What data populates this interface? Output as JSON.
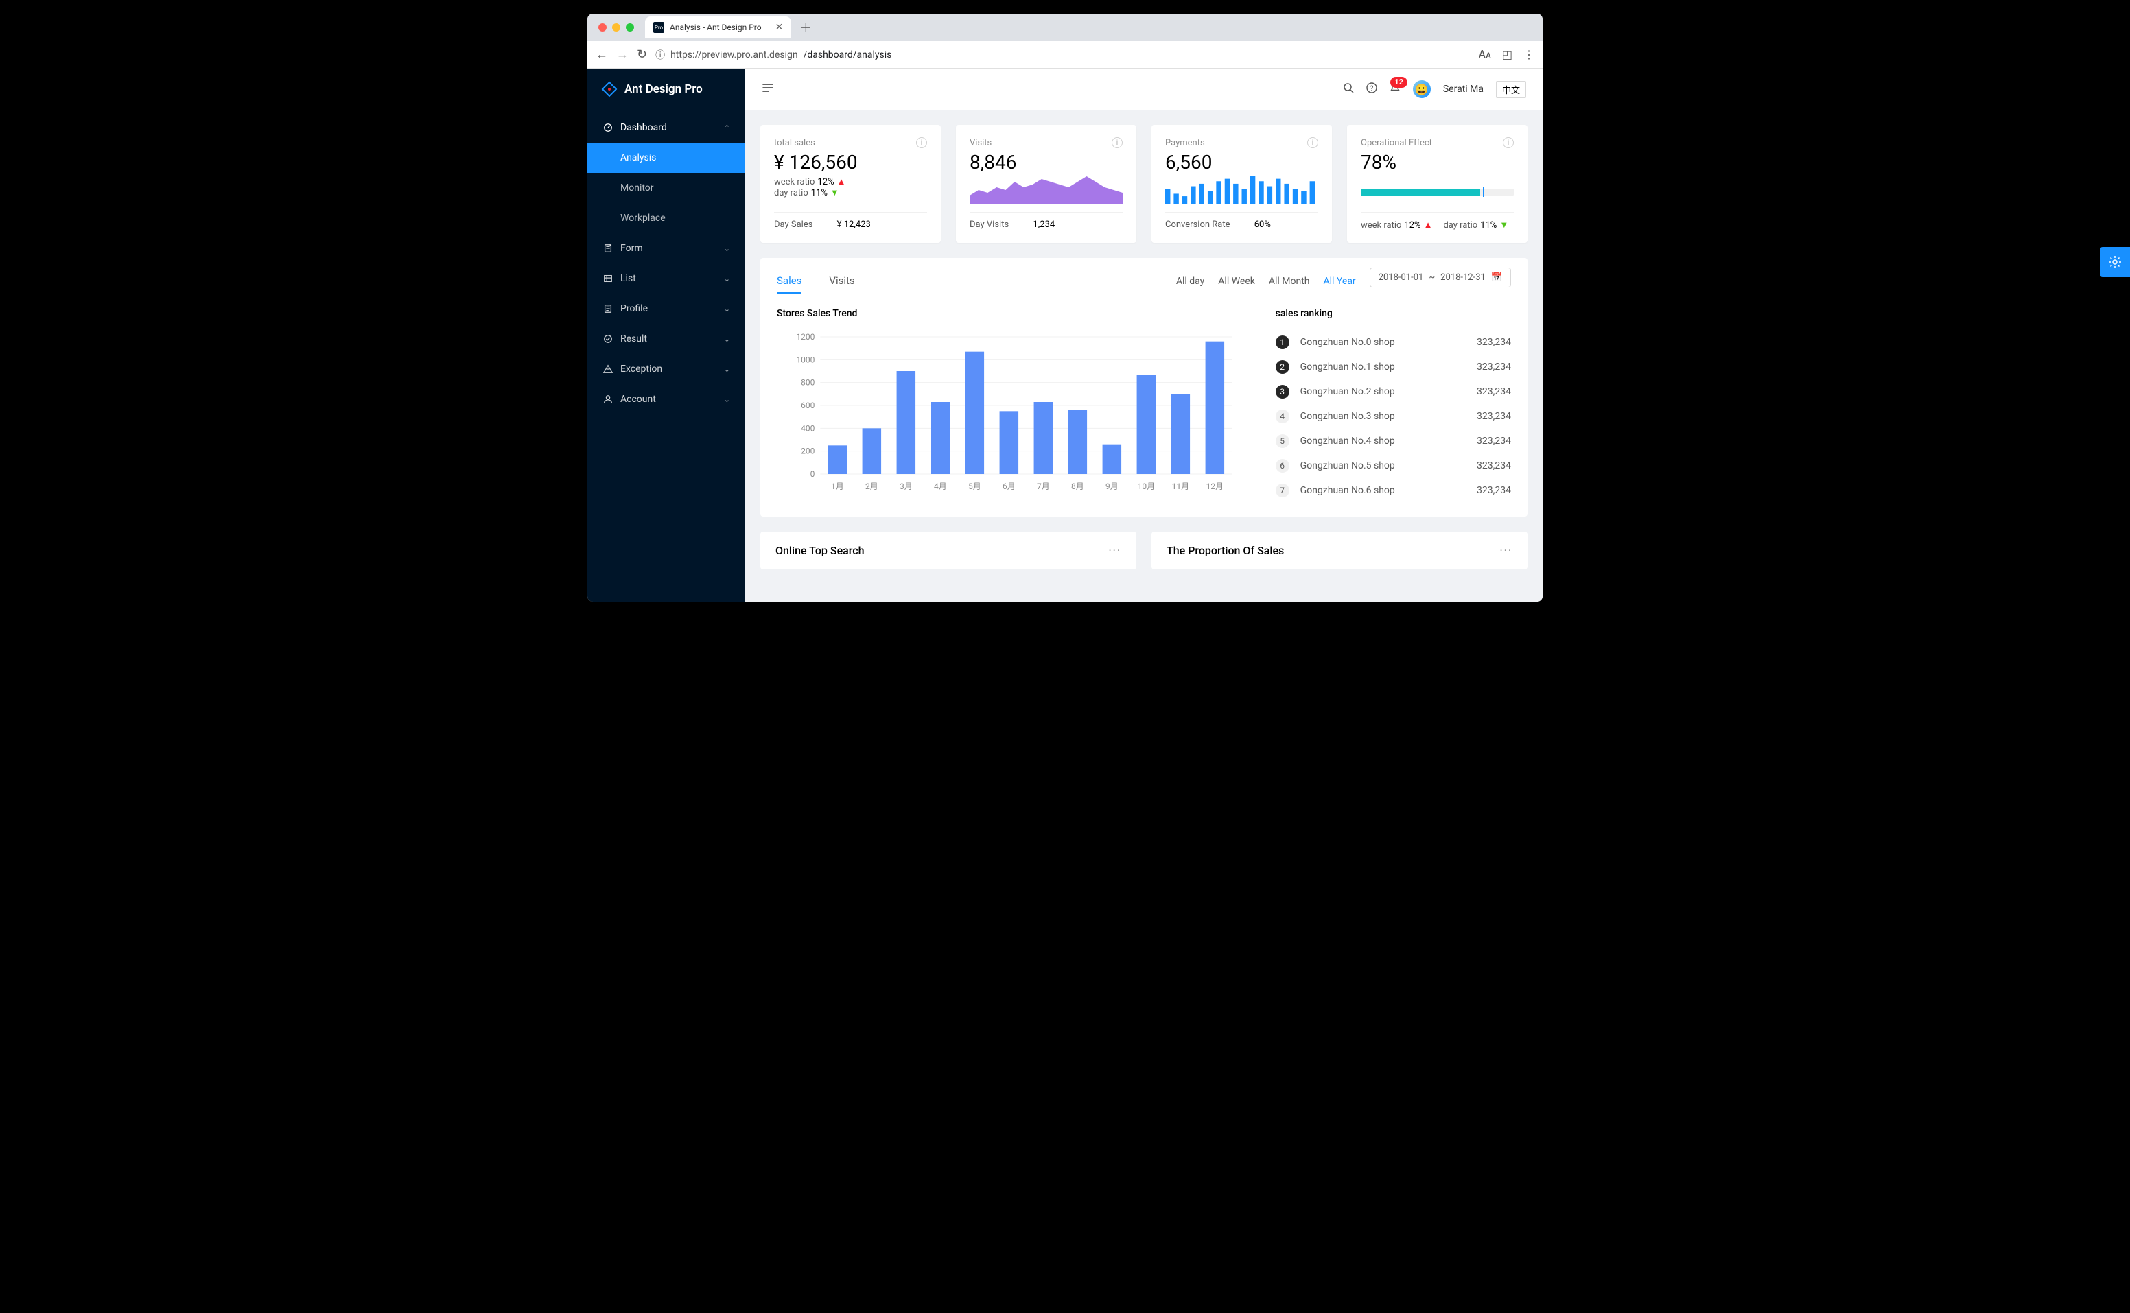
{
  "browser": {
    "tab_title": "Analysis - Ant Design Pro",
    "tab_favicon": "Pro",
    "url_host": "https://preview.pro.ant.design",
    "url_path": "/dashboard/analysis"
  },
  "colors": {
    "traffic_red": "#ff5f56",
    "traffic_yellow": "#ffbd2e",
    "traffic_green": "#27c93f",
    "primary": "#1890ff",
    "sidebar_bg": "#001529"
  },
  "app": {
    "brand": "Ant Design Pro",
    "notification_count": "12",
    "user_name": "Serati Ma",
    "lang_label": "中文"
  },
  "sidebar": {
    "items": [
      {
        "icon": "dashboard-icon",
        "label": "Dashboard",
        "expanded": true,
        "children": [
          {
            "label": "Analysis",
            "active": true
          },
          {
            "label": "Monitor"
          },
          {
            "label": "Workplace"
          }
        ]
      },
      {
        "icon": "form-icon",
        "label": "Form"
      },
      {
        "icon": "list-icon",
        "label": "List"
      },
      {
        "icon": "profile-icon",
        "label": "Profile"
      },
      {
        "icon": "result-icon",
        "label": "Result"
      },
      {
        "icon": "exception-icon",
        "label": "Exception"
      },
      {
        "icon": "account-icon",
        "label": "Account"
      }
    ]
  },
  "kpi": [
    {
      "title": "total sales",
      "value": "¥ 126,560",
      "body_type": "ratios",
      "ratios": [
        {
          "label": "week ratio",
          "value": "12%",
          "dir": "up"
        },
        {
          "label": "day ratio",
          "value": "11%",
          "dir": "down"
        }
      ],
      "footer": [
        {
          "label": "Day Sales",
          "value": "¥ 12,423"
        }
      ]
    },
    {
      "title": "Visits",
      "value": "8,846",
      "body_type": "area",
      "footer": [
        {
          "label": "Day Visits",
          "value": "1,234"
        }
      ]
    },
    {
      "title": "Payments",
      "value": "6,560",
      "body_type": "bars",
      "footer": [
        {
          "label": "Conversion Rate",
          "value": "60%"
        }
      ]
    },
    {
      "title": "Operational Effect",
      "value": "78%",
      "body_type": "progress",
      "progress": 78,
      "marker": 80,
      "footer_ratios": [
        {
          "label": "week ratio",
          "value": "12%",
          "dir": "up"
        },
        {
          "label": "day ratio",
          "value": "11%",
          "dir": "down"
        }
      ]
    }
  ],
  "sales_panel": {
    "tabs": [
      "Sales",
      "Visits"
    ],
    "active_tab": 0,
    "range_options": [
      "All day",
      "All Week",
      "All Month",
      "All Year"
    ],
    "active_range": 3,
    "date_from": "2018-01-01",
    "date_to": "2018-12-31",
    "date_sep": "~",
    "chart_title": "Stores Sales Trend",
    "rank_title": "sales ranking",
    "ranking": [
      {
        "rank": 1,
        "name": "Gongzhuan No.0 shop",
        "value": "323,234"
      },
      {
        "rank": 2,
        "name": "Gongzhuan No.1 shop",
        "value": "323,234"
      },
      {
        "rank": 3,
        "name": "Gongzhuan No.2 shop",
        "value": "323,234"
      },
      {
        "rank": 4,
        "name": "Gongzhuan No.3 shop",
        "value": "323,234"
      },
      {
        "rank": 5,
        "name": "Gongzhuan No.4 shop",
        "value": "323,234"
      },
      {
        "rank": 6,
        "name": "Gongzhuan No.5 shop",
        "value": "323,234"
      },
      {
        "rank": 7,
        "name": "Gongzhuan No.6 shop",
        "value": "323,234"
      }
    ]
  },
  "bottom": {
    "left_title": "Online Top Search",
    "right_title": "The Proportion Of Sales"
  },
  "chart_data": {
    "type": "bar",
    "title": "Stores Sales Trend",
    "xlabel": "",
    "ylabel": "",
    "categories": [
      "1月",
      "2月",
      "3月",
      "4月",
      "5月",
      "6月",
      "7月",
      "8月",
      "9月",
      "10月",
      "11月",
      "12月"
    ],
    "values": [
      250,
      400,
      900,
      630,
      1070,
      550,
      630,
      560,
      260,
      870,
      700,
      1160
    ],
    "ylim": [
      0,
      1200
    ],
    "yticks": [
      0,
      200,
      400,
      600,
      800,
      1000,
      1200
    ],
    "series_color": "#5b8ff9"
  },
  "mini_area": {
    "type": "area",
    "values": [
      3,
      5,
      4,
      6,
      5,
      8,
      6,
      7,
      9,
      8,
      7,
      6,
      8,
      10,
      8,
      6,
      5,
      4
    ],
    "color": "#975fe4"
  },
  "mini_bars": {
    "type": "bar",
    "values": [
      6,
      4,
      3,
      7,
      8,
      5,
      9,
      10,
      8,
      6,
      11,
      9,
      7,
      10,
      8,
      6,
      5,
      9
    ],
    "color": "#1890ff"
  }
}
